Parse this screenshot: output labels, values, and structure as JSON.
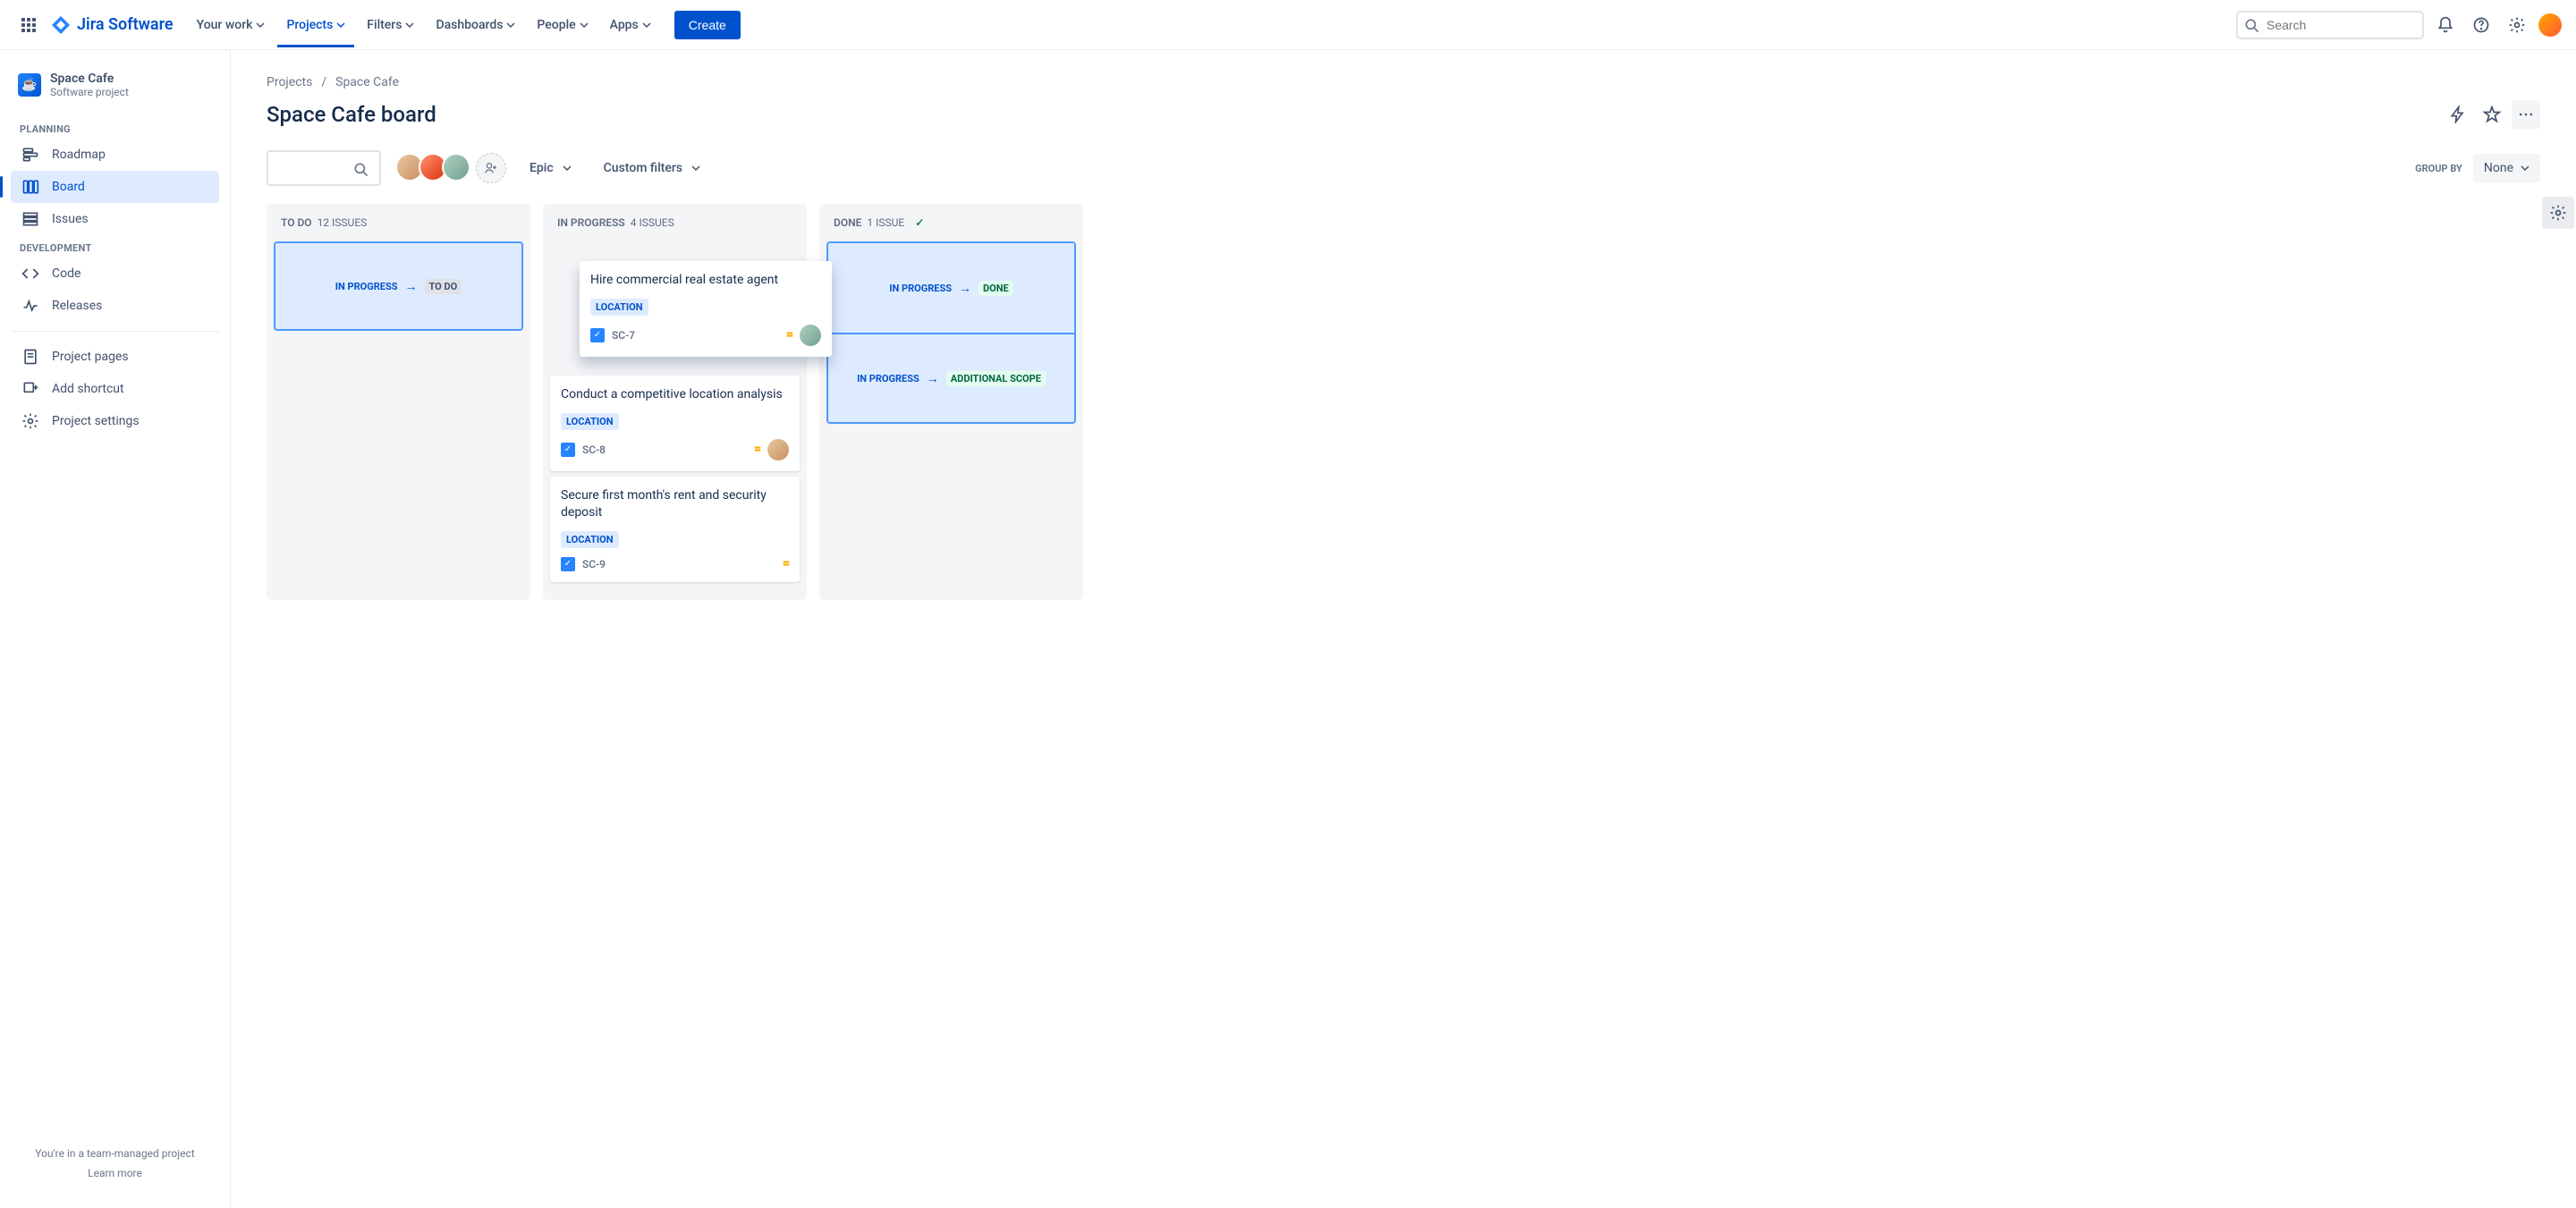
{
  "top": {
    "logo": "Jira Software",
    "nav": [
      "Your work",
      "Projects",
      "Filters",
      "Dashboards",
      "People",
      "Apps"
    ],
    "active_index": 1,
    "create": "Create",
    "search_placeholder": "Search"
  },
  "sidebar": {
    "project_name": "Space Cafe",
    "project_type": "Software project",
    "section1": "PLANNING",
    "planning": [
      "Roadmap",
      "Board",
      "Issues"
    ],
    "planning_selected": 1,
    "section2": "DEVELOPMENT",
    "development": [
      "Code",
      "Releases"
    ],
    "bottom": [
      "Project pages",
      "Add shortcut",
      "Project settings"
    ],
    "footer_line": "You're in a team-managed project",
    "footer_link": "Learn more"
  },
  "breadcrumbs": [
    "Projects",
    "Space Cafe"
  ],
  "page_title": "Space Cafe board",
  "controls": {
    "epic": "Epic",
    "custom_filters": "Custom filters",
    "group_by_label": "GROUP BY",
    "group_by_value": "None"
  },
  "columns": [
    {
      "name": "TO DO",
      "count": "12 ISSUES"
    },
    {
      "name": "IN PROGRESS",
      "count": "4 ISSUES"
    },
    {
      "name": "DONE",
      "count": "1 ISSUE",
      "done": true
    }
  ],
  "transitions": {
    "todo": {
      "from": "IN PROGRESS",
      "to": "TO DO"
    },
    "done_top": {
      "from": "IN PROGRESS",
      "to": "DONE"
    },
    "done_bottom": {
      "from": "IN PROGRESS",
      "to": "ADDITIONAL SCOPE"
    }
  },
  "cards": {
    "dragging": {
      "title": "Hire commercial real estate agent",
      "label": "LOCATION",
      "key": "SC-7"
    },
    "c2": {
      "title": "Conduct a competitive location analysis",
      "label": "LOCATION",
      "key": "SC-8"
    },
    "c3": {
      "title": "Secure first month's rent and security deposit",
      "label": "LOCATION",
      "key": "SC-9"
    }
  }
}
